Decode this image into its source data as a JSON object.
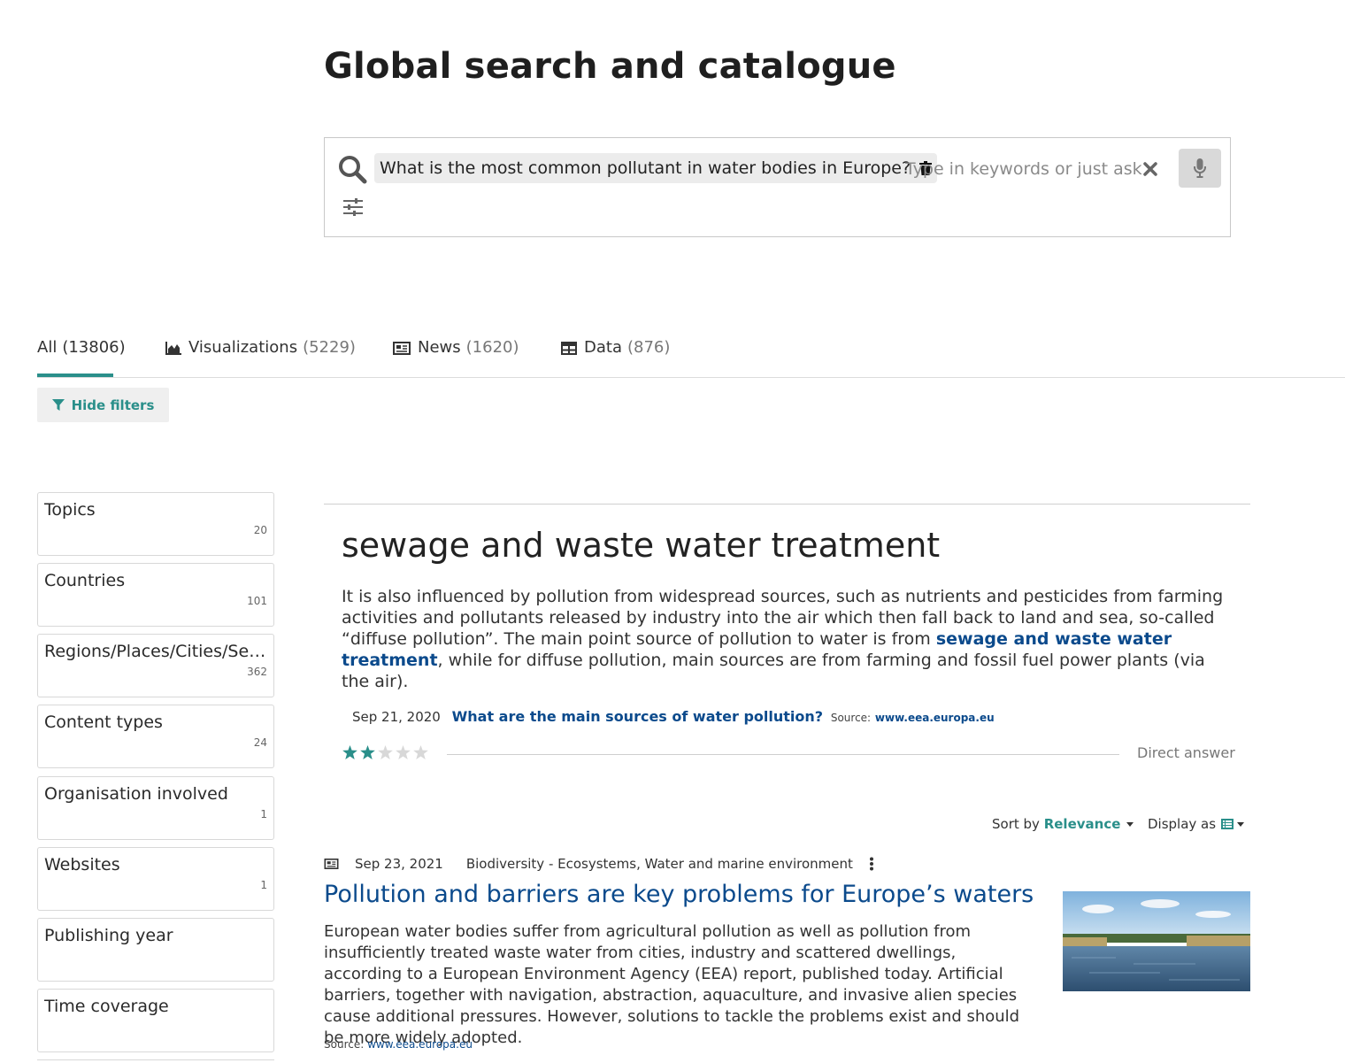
{
  "page": {
    "title": "Global search and catalogue"
  },
  "search": {
    "query": "What is the most common pollutant in water bodies in Europe?",
    "placeholder": "Type in keywords or just ask"
  },
  "tabs": [
    {
      "label": "All",
      "count": "(13806)",
      "icon": ""
    },
    {
      "label": "Visualizations",
      "count": "(5229)",
      "icon": "chart-area-icon"
    },
    {
      "label": "News",
      "count": "(1620)",
      "icon": "newspaper-icon"
    },
    {
      "label": "Data",
      "count": "(876)",
      "icon": "table-icon"
    }
  ],
  "filters_toggle": {
    "label": "Hide filters"
  },
  "facets": [
    {
      "label": "Topics",
      "count": "20"
    },
    {
      "label": "Countries",
      "count": "101"
    },
    {
      "label": "Regions/Places/Cities/Seas...",
      "count": "362"
    },
    {
      "label": "Content types",
      "count": "24"
    },
    {
      "label": "Organisation involved",
      "count": "1"
    },
    {
      "label": "Websites",
      "count": "1"
    },
    {
      "label": "Publishing year",
      "count": ""
    },
    {
      "label": "Time coverage",
      "count": ""
    }
  ],
  "answer": {
    "title": "sewage and waste water treatment",
    "text_before": "It is also influenced by pollution from widespread sources, such as nutrients and pesticides from farming activities and pollutants released by industry into the air which then fall back to land and sea, so-called “diffuse pollution”. The main point source of pollution to water is from ",
    "highlight": "sewage and waste water treatment",
    "text_after": ", while for diffuse pollution, main sources are from farming and fossil fuel power plants (via the air).",
    "date": "Sep 21, 2020",
    "source_title": "What are the main sources of water pollution?",
    "source_label": "Source:",
    "source_domain": "www.eea.europa.eu",
    "rating": 2,
    "rating_max": 5,
    "badge": "Direct answer"
  },
  "sort": {
    "label": "Sort by",
    "value": "Relevance"
  },
  "display": {
    "label": "Display as"
  },
  "results": [
    {
      "date": "Sep 23, 2021",
      "topics": "Biodiversity - Ecosystems, Water and marine environment",
      "title": "Pollution and barriers are key problems for Europe’s waters",
      "description": "European water bodies suffer from agricultural pollution as well as pollution from insufficiently treated waste water from cities, industry and scattered dwellings, according to a European Environment Agency (EEA) report, published today. Artificial barriers, together with navigation, abstraction, aquaculture, and invasive alien species cause additional pressures. However, solutions to tackle the problems exist and should be more widely adopted.",
      "source_label": "Source:",
      "source_domain": "www.eea.europa.eu",
      "type_icon": "newspaper-icon"
    }
  ],
  "colors": {
    "accent": "#2a8f8a",
    "link": "#0b4a8c"
  }
}
